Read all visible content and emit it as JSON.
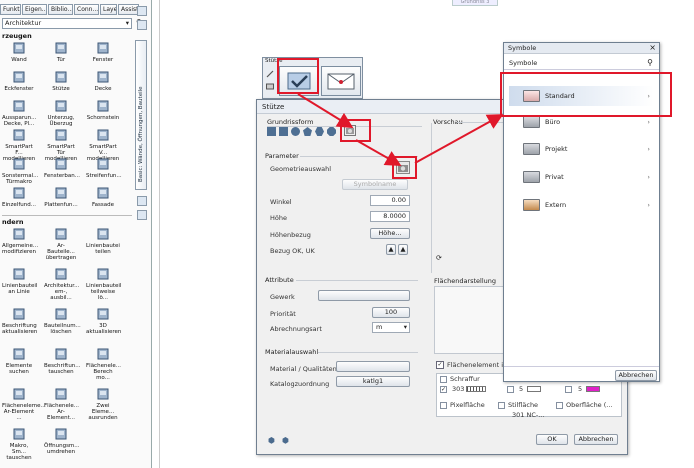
{
  "left_panel": {
    "tabs": [
      "Funkti",
      "Eigen...",
      "Biblio...",
      "Conn...",
      "Layer",
      "Assist..."
    ],
    "library_select": "Architektur",
    "section1_title": "rzeugen",
    "section2_title": "ndern",
    "vertical_tab_label": "Basic: Wände, Öffnungen, Bauteile",
    "items_create": [
      {
        "label": "Wand"
      },
      {
        "label": "Tür"
      },
      {
        "label": "Fenster"
      },
      {
        "label": "Eckfenster"
      },
      {
        "label": "Stütze"
      },
      {
        "label": "Decke"
      },
      {
        "label": "Aussparun...\nDecke, Pl..."
      },
      {
        "label": "Unterzug,\nÜberzug"
      },
      {
        "label": "Schornstein"
      },
      {
        "label": "SmartPart F...\nmodellieren"
      },
      {
        "label": "SmartPart Tür\nmodellieren"
      },
      {
        "label": "SmartPart V...\nmodellieren"
      },
      {
        "label": "Sonstermal...\nTürmakro"
      },
      {
        "label": "Fensterban..."
      },
      {
        "label": "Streifenfun..."
      },
      {
        "label": "Einzelfund..."
      },
      {
        "label": "Plattenfun..."
      },
      {
        "label": "Fassade"
      }
    ],
    "items_modify": [
      {
        "label": "Allgemeine...\nmodifizieren"
      },
      {
        "label": "Ar-Bauteile...\nübertragen"
      },
      {
        "label": "Linienbautei\nteilen"
      },
      {
        "label": "Linienbauteil\nan Linie"
      },
      {
        "label": "Architektur...\nem-, ausbil..."
      },
      {
        "label": "Linienbauteil\nteilweise lö..."
      },
      {
        "label": "Beschriftung\naktualisieren"
      },
      {
        "label": "Bauteilnum...\nlöschen"
      },
      {
        "label": "3D\naktualisieren"
      },
      {
        "label": "Elemente\nsuchen"
      },
      {
        "label": "Beschriftun...\ntauschen"
      },
      {
        "label": "Flächenele...\nBerech mo..."
      },
      {
        "label": "Flächeneleme...\nAr-Element ..."
      },
      {
        "label": "Flächenele...\nAr-Element..."
      },
      {
        "label": "Zwei Eleme...\nausrunden"
      },
      {
        "label": "Makro, Sm...\ntauschen"
      },
      {
        "label": "Öffnungsm...\numdrehen"
      }
    ]
  },
  "top_button_label": "Grundriss 3",
  "mini_toolbar": {
    "title": "Stütze"
  },
  "dialog": {
    "title": "Stütze",
    "grundrissform_label": "Grundrissform",
    "vorschau_label": "Vorschau",
    "parameter_label": "Parameter",
    "geometrieauswahl_label": "Geometrieauswahl",
    "symbolname_btn": "Symbolname",
    "winkel_label": "Winkel",
    "winkel_value": "0.00",
    "hoehe_label": "Höhe",
    "hoehe_value": "8.0000",
    "hoehenbezug_label": "Höhenbezug",
    "hoehenbezug_btn": "Höhe...",
    "bezug_label": "Bezug OK, UK",
    "attribute_label": "Attribute",
    "gewerk_label": "Gewerk",
    "prioritaet_label": "Priorität",
    "prioritaet_value": "100",
    "abrechnungsart_label": "Abrechnungsart",
    "abrechnungsart_value": "m",
    "flaechendarstellung_label": "Flächendarstellung",
    "materialauswahl_label": "Materialauswahl",
    "material_label": "Material / Qualitäten",
    "katalog_label": "Katalogzuordnung",
    "katalog_btn": "katlg1",
    "flaechenelement_label": "Flächenelement im G",
    "schraffur_label": "Schraffur",
    "schraffur_value": "303",
    "num5a": "5",
    "num5b": "5",
    "pixelflaeche_label": "Pixelfläche",
    "stilflaeche_label": "Stilfläche",
    "oberflaeche_label": "Oberfläche (...",
    "stil_value": "301 NC-...",
    "ok_btn": "OK",
    "cancel_btn": "Abbrechen"
  },
  "symbol_panel": {
    "title": "Symbole",
    "subtitle": "Symbole",
    "items": [
      {
        "label": "Standard"
      },
      {
        "label": "Büro"
      },
      {
        "label": "Projekt"
      },
      {
        "label": "Privat"
      },
      {
        "label": "Extern"
      }
    ],
    "cancel_btn": "Abbrechen"
  },
  "colors": {
    "highlight": "#e0182a",
    "accent_blue": "#4e6f93",
    "magenta": "#e020c8"
  }
}
